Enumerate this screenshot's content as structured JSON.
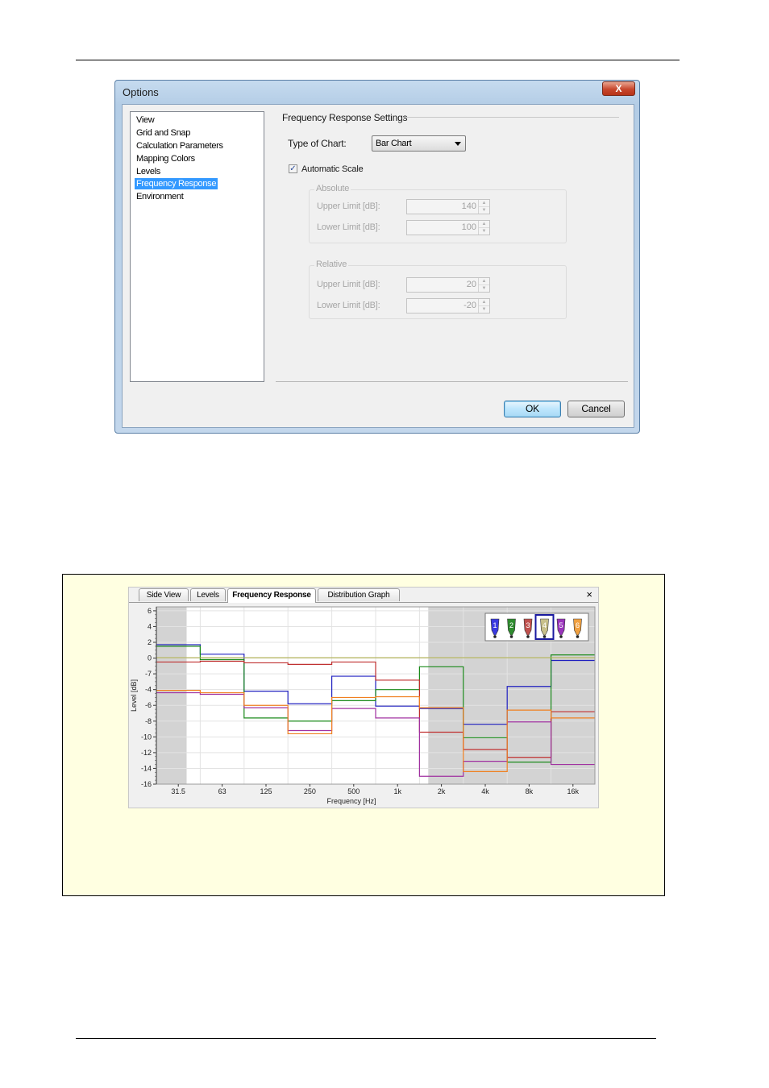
{
  "dialog": {
    "title": "Options",
    "close_label": "X",
    "tree_items": [
      "View",
      "Grid and Snap",
      "Calculation Parameters",
      "Mapping Colors",
      "Levels",
      "Frequency Response",
      "Environment"
    ],
    "selected_item": "Frequency Response",
    "section_title": "Frequency Response Settings",
    "chart_type_label": "Type of Chart:",
    "chart_type_value": "Bar Chart",
    "auto_scale_label": "Automatic Scale",
    "auto_scale_checked": true,
    "absolute": {
      "title": "Absolute",
      "upper_label": "Upper Limit [dB]:",
      "upper_value": "140",
      "lower_label": "Lower Limit [dB]:",
      "lower_value": "100"
    },
    "relative": {
      "title": "Relative",
      "upper_label": "Upper Limit [dB]:",
      "upper_value": "20",
      "lower_label": "Lower Limit [dB]:",
      "lower_value": "-20"
    },
    "ok_label": "OK",
    "cancel_label": "Cancel"
  },
  "freq_panel": {
    "tabs": [
      "Side View",
      "Levels",
      "Frequency Response",
      "Distribution Graph"
    ],
    "active_tab": "Frequency Response",
    "close_label": "×"
  },
  "chart_data": {
    "type": "line",
    "step": true,
    "xlabel": "Frequency [Hz]",
    "ylabel": "Level [dB]",
    "categories": [
      "31.5",
      "63",
      "125",
      "250",
      "500",
      "1k",
      "2k",
      "4k",
      "8k",
      "16k"
    ],
    "y_ticks": [
      6,
      4,
      2,
      0,
      -2,
      -4,
      -6,
      -8,
      -10,
      -12,
      -14,
      -16
    ],
    "y_tick_labels": [
      "6",
      "4",
      "2",
      "0",
      "-7",
      "-4",
      "-6",
      "-8",
      "-10",
      "-12",
      "-14",
      "-16"
    ],
    "ylim": [
      -16,
      6.5
    ],
    "grid": true,
    "shaded_bands": [
      {
        "from_band": 0,
        "to_band": 0.69
      },
      {
        "from_band": 6.2,
        "to_band": 10
      }
    ],
    "legend_markers": [
      "1",
      "2",
      "3",
      "4",
      "5",
      "6"
    ],
    "legend_colors": [
      "#3a3ae0",
      "#2e8b2e",
      "#c0504d",
      "#c8c08a",
      "#9933bb",
      "#f0a040"
    ],
    "legend_selected": "4",
    "series": [
      {
        "color": "#2020c0",
        "values": [
          1.7,
          0.5,
          -4.2,
          -5.8,
          -2.3,
          -6.1,
          -6.4,
          -8.4,
          -3.6,
          -0.3
        ]
      },
      {
        "color": "#1a8a1a",
        "values": [
          1.5,
          -0.2,
          -7.6,
          -8.0,
          -5.4,
          -4.0,
          -1.1,
          -10.1,
          -13.2,
          0.4
        ]
      },
      {
        "color": "#c03030",
        "values": [
          -0.5,
          -0.4,
          -0.6,
          -0.8,
          -0.5,
          -2.8,
          -9.4,
          -11.6,
          -12.6,
          -6.8
        ]
      },
      {
        "color": "#b0b050",
        "values": [
          0.05,
          0.05,
          0.05,
          0.05,
          0.05,
          0.05,
          0.05,
          0.05,
          0.05,
          0.05
        ]
      },
      {
        "color": "#a030a0",
        "values": [
          -4.4,
          -4.6,
          -6.3,
          -9.2,
          -6.4,
          -7.6,
          -15.0,
          -13.1,
          -8.1,
          -13.5
        ]
      },
      {
        "color": "#f08020",
        "values": [
          -4.1,
          -4.4,
          -6.0,
          -9.6,
          -5.0,
          -4.9,
          -6.3,
          -14.4,
          -6.6,
          -7.6
        ]
      }
    ]
  }
}
